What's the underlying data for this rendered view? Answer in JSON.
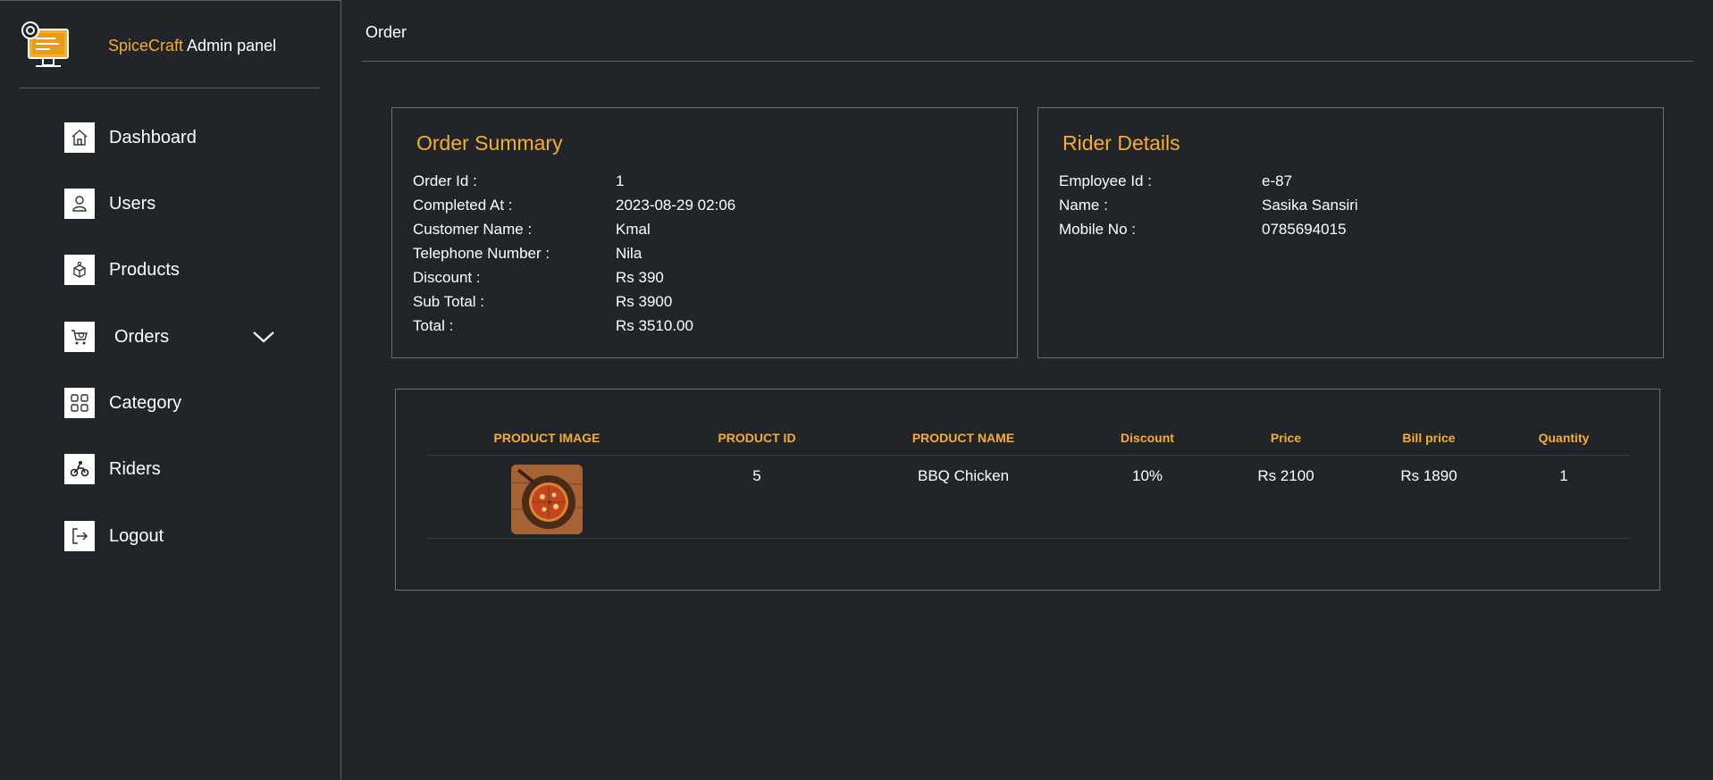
{
  "brand": {
    "name_accent": "SpiceCraft",
    "name_rest": " Admin panel",
    "logo_icon": "monitor-gear-icon"
  },
  "sidebar": {
    "items": [
      {
        "label": "Dashboard",
        "icon": "home-icon"
      },
      {
        "label": "Users",
        "icon": "user-icon"
      },
      {
        "label": "Products",
        "icon": "products-icon"
      },
      {
        "label": "Orders",
        "icon": "cart-icon",
        "expandable": true
      },
      {
        "label": "Category",
        "icon": "grid-icon"
      },
      {
        "label": "Riders",
        "icon": "motorbike-icon"
      },
      {
        "label": "Logout",
        "icon": "logout-icon"
      }
    ]
  },
  "header": {
    "title": "Order"
  },
  "order_summary": {
    "title": "Order Summary",
    "rows": [
      {
        "label": "Order Id :",
        "value": "1"
      },
      {
        "label": "Completed At :",
        "value": "2023-08-29 02:06"
      },
      {
        "label": "Customer Name :",
        "value": "Kmal"
      },
      {
        "label": "Telephone Number :",
        "value": "Nila"
      },
      {
        "label": "Discount :",
        "value": "Rs 390"
      },
      {
        "label": "Sub Total :",
        "value": "Rs 3900"
      },
      {
        "label": "Total :",
        "value": "Rs 3510.00"
      }
    ]
  },
  "rider_details": {
    "title": "Rider Details",
    "rows": [
      {
        "label": "Employee Id :",
        "value": "e-87"
      },
      {
        "label": "Name :",
        "value": "Sasika Sansiri"
      },
      {
        "label": "Mobile No :",
        "value": "0785694015"
      }
    ]
  },
  "products_table": {
    "columns": [
      "PRODUCT IMAGE",
      "PRODUCT ID",
      "PRODUCT NAME",
      "Discount",
      "Price",
      "Bill price",
      "Quantity"
    ],
    "rows": [
      {
        "image": "pizza-image",
        "product_id": "5",
        "product_name": "BBQ Chicken",
        "discount": "10%",
        "price": "Rs 2100",
        "bill_price": "Rs 1890",
        "quantity": "1"
      }
    ]
  },
  "colors": {
    "accent": "#f6ae2d",
    "background": "#212429",
    "border": "#6b6e73"
  }
}
